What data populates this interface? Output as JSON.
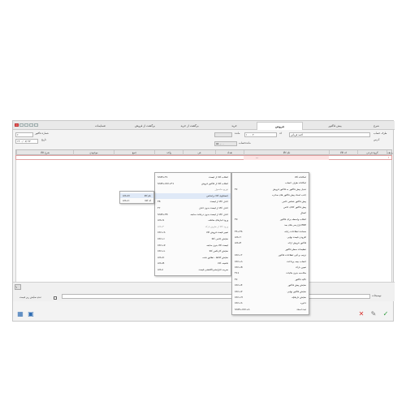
{
  "tabs": [
    {
      "label": "شرح"
    },
    {
      "label": "پیش فاکتور"
    },
    {
      "label": "فروش"
    },
    {
      "label": "خرید"
    },
    {
      "label": "برگشت از خرید"
    },
    {
      "label": "برگشت از فروش"
    },
    {
      "label": "ضمایمات"
    }
  ],
  "header": {
    "party_label": "طرف حساب",
    "party_value": "احمد قربانی",
    "address_label": "آدرس",
    "code_label": "کد",
    "code_value": "۱۰۰۰۰۲",
    "remain_label": "مانده",
    "balance_label": "مانده‌حساب",
    "balance_value": "۵۸۰,۰۰۰",
    "invoice_no_label": "شماره فاکتور",
    "invoice_no_value": "۶",
    "date_label": "تاریخ",
    "date_value": "۱۴۰۰/ ۰۷/ ۲۲"
  },
  "grid": {
    "columns": [
      "ردیف",
      "گروه فرعی",
      "کد کالا",
      "نام کالا",
      "تعداد",
      "فی",
      "واحد",
      "جمع",
      "موجودی",
      "شرح کالا"
    ],
    "first_row_mark": "۱",
    "first_row_code": "---"
  },
  "context_menu": {
    "items": [
      {
        "text": "انتخاب کالا از لیست",
        "key": "Shift+F1",
        "disabled": false
      },
      {
        "text": "انتخاب کالا از فاکتور فروش",
        "key": "Shift+Ctrl+F1",
        "disabled": false
      },
      {
        "text": "توزیع محصول",
        "key": "",
        "disabled": true
      },
      {
        "text": "جستجوی کالا براساس",
        "key": "",
        "disabled": false
      },
      {
        "text": "حذف کالا از لیست",
        "key": "F8",
        "disabled": false
      },
      {
        "text": "حذف کالا از لیست بدون حذف",
        "key": "F7",
        "disabled": false
      },
      {
        "text": "حذف کالا از لیست بدون دریافت سابقه",
        "key": "Shift+F8",
        "disabled": false
      },
      {
        "text": "ورود انبارهای مختلف",
        "key": "Alt+S",
        "disabled": false
      },
      {
        "text": "ورود کالا از طریق بارکد",
        "key": "Alt+F",
        "disabled": true
      },
      {
        "text": "تغییر قیمت فروش کالا",
        "key": "Ctrl+S",
        "disabled": false
      },
      {
        "text": "نمایش جانبی کالا",
        "key": "Ctrl+I",
        "disabled": false
      },
      {
        "text": "لیست کالا بدون سابقه",
        "key": "Ctrl+Z",
        "disabled": false
      },
      {
        "text": "نمایش کارتکس کالا",
        "key": "Ctrl+L",
        "disabled": false
      },
      {
        "text": "نمایش کالاها - تطابق شده",
        "key": "Alt+K",
        "disabled": false
      },
      {
        "text": "تخفیف کالا",
        "key": "Alt+B",
        "disabled": false
      },
      {
        "text": "ضریب افزایشی/کاهشی قیمت",
        "key": "Alt+I",
        "disabled": false
      }
    ]
  },
  "submenu": {
    "items": [
      {
        "text": "نام کالا",
        "key": "Alt+N"
      },
      {
        "text": "کد کالا",
        "key": "Alt+C"
      }
    ]
  },
  "right_menu": {
    "items": [
      {
        "text": "امکانات کالا",
        "key": ""
      },
      {
        "text": "امکانات طرف حساب",
        "key": ""
      },
      {
        "text": "تبدیل پیش فاکتور به فاکتور فروش",
        "key": "F2"
      },
      {
        "text": "جذب اسناد پیش فاکتور های صادره",
        "key": ""
      },
      {
        "text": "پیش فاکتور شخص خاص",
        "key": ""
      },
      {
        "text": "پیش فاکتور کالای خاص",
        "key": ""
      },
      {
        "text": "اتصال",
        "key": ""
      },
      {
        "text": "انتخاب واسطه برای فاکتور",
        "key": "F9"
      },
      {
        "text": "بازارسی های بعد ERP",
        "key": ""
      },
      {
        "text": "ضمانت اطلاعات رایانه",
        "key": "F5+F6"
      },
      {
        "text": "افزودن قیمت نهایی",
        "key": "Alt+Y"
      },
      {
        "text": "فاکتور فروش ارائه",
        "key": "Alt+E"
      },
      {
        "text": "تنظیمات سطر فاکتور",
        "key": ""
      },
      {
        "text": "ترتیب و کپی اطلاعات فاکتور",
        "key": "Ctrl+T"
      },
      {
        "text": "حساب بیمه پرداخت",
        "key": "Ctrl+A"
      },
      {
        "text": "تعیین بارکد",
        "key": "Ctrl+B"
      },
      {
        "text": "محاسبه بدون مالیات",
        "key": "F11"
      },
      {
        "text": "تاکید فاکتور",
        "key": "F2"
      },
      {
        "text": "نمایش پیش فاکتور",
        "key": "Ctrl+E"
      },
      {
        "text": "نمایش فاکتور نهایی",
        "key": "Ctrl+P"
      },
      {
        "text": "نمایش تاریخچه",
        "key": "Ctrl+H"
      },
      {
        "text": "ذخیره",
        "key": "Ctrl+S"
      },
      {
        "text": "ثبت اسناد",
        "key": "Shift+Ctrl+A"
      }
    ]
  },
  "bottom": {
    "notes_label": "توضیحات",
    "show_row_price_label": "عدم نمایش ریز قیمت",
    "page_indicator": "۱"
  },
  "colors": {
    "accent": "#2f6db3",
    "row_highlight": "#fde4e4",
    "menu_hover": "#dfe9f7",
    "delete_red": "#d9302c",
    "confirm_green": "#2d9a3b"
  }
}
